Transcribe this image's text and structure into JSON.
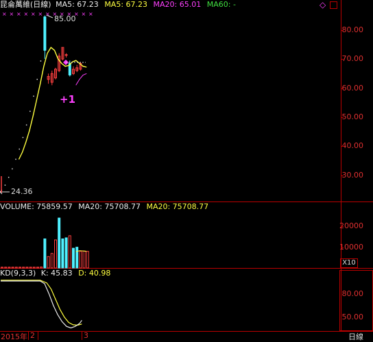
{
  "price_panel": {
    "name": "昆侖萬維(日線)",
    "ma_label_1": "MA5: 67.23",
    "ma_label_2": "MA5: 67.23",
    "ma_label_3": "MA20: 65.01",
    "ma_label_4": "MA60: -",
    "high_label": "85.00",
    "low_label": "24.36",
    "signal_label": "+1",
    "y_ticks": [
      "80.00",
      "70.00",
      "60.00",
      "50.00",
      "40.00",
      "30.00"
    ]
  },
  "volume_panel": {
    "label_1": "VOLUME: 75859.57",
    "label_2": "MA20: 75708.77",
    "label_3": "MA20: 75708.77",
    "y_ticks": [
      "20000",
      "10000"
    ],
    "unit": "X10"
  },
  "kd_panel": {
    "label_1": "KD(9,3,3)",
    "label_2": "K: 45.83",
    "label_3": "D: 40.98",
    "y_ticks": [
      "80.00",
      "50.00"
    ]
  },
  "footer": {
    "date_1": "2015年",
    "date_2": "2",
    "date_3": "3",
    "period": "日線"
  },
  "colors": {
    "up": "#ff4040",
    "down": "#4ff0ff",
    "ma_yellow": "#ffff40",
    "magenta": "#ff40ff",
    "green": "#40e040",
    "axis_red": "#b00000"
  },
  "chart_data": [
    {
      "type": "candlestick",
      "y_range": [
        21,
        87
      ],
      "x": [
        1,
        2,
        3,
        4,
        5,
        6,
        7,
        8,
        9,
        10,
        11,
        12,
        13,
        14,
        15,
        16,
        17,
        18,
        19,
        20,
        21,
        22,
        23,
        24,
        25,
        26,
        27,
        28,
        29,
        30,
        31,
        32,
        33,
        34,
        35,
        36,
        37,
        38,
        39,
        40,
        41,
        42,
        43,
        44,
        45,
        46,
        47,
        48,
        49,
        50,
        51,
        52,
        53,
        54,
        55,
        56,
        57,
        58,
        59,
        60,
        61,
        62,
        63
      ],
      "ohlc_note": "open/high/low/close per bar",
      "bars": [
        {
          "o": 24.36,
          "h": 24.36,
          "l": 24.36,
          "c": 24.36
        },
        {
          "o": 26.8,
          "h": 26.8,
          "l": 26.8,
          "c": 26.8
        },
        {
          "o": 29.5,
          "h": 29.5,
          "l": 29.5,
          "c": 29.5
        },
        {
          "o": 32.4,
          "h": 32.4,
          "l": 32.4,
          "c": 32.4
        },
        {
          "o": 35.7,
          "h": 35.7,
          "l": 35.7,
          "c": 35.7
        },
        {
          "o": 39.2,
          "h": 39.2,
          "l": 39.2,
          "c": 39.2
        },
        {
          "o": 43.2,
          "h": 43.2,
          "l": 43.2,
          "c": 43.2
        },
        {
          "o": 47.5,
          "h": 47.5,
          "l": 47.5,
          "c": 47.5
        },
        {
          "o": 52.2,
          "h": 52.2,
          "l": 52.2,
          "c": 52.2
        },
        {
          "o": 57.4,
          "h": 57.4,
          "l": 57.4,
          "c": 57.4
        },
        {
          "o": 63.2,
          "h": 63.2,
          "l": 63.2,
          "c": 63.2
        },
        {
          "o": 69.5,
          "h": 69.5,
          "l": 69.5,
          "c": 69.5
        },
        {
          "o": 84.5,
          "h": 85.0,
          "l": 70.0,
          "c": 73.0
        },
        {
          "o": 63.0,
          "h": 65.0,
          "l": 61.5,
          "c": 64.0
        },
        {
          "o": 62.0,
          "h": 66.0,
          "l": 61.0,
          "c": 65.0
        },
        {
          "o": 63.5,
          "h": 67.0,
          "l": 63.0,
          "c": 66.5
        },
        {
          "o": 66.0,
          "h": 72.0,
          "l": 65.5,
          "c": 71.0
        },
        {
          "o": 70.0,
          "h": 74.0,
          "l": 69.5,
          "c": 74.0
        },
        {
          "o": 71.5,
          "h": 72.0,
          "l": 70.5,
          "c": 71.5
        },
        {
          "o": 68.5,
          "h": 69.5,
          "l": 64.0,
          "c": 64.5
        },
        {
          "o": 65.0,
          "h": 67.5,
          "l": 64.5,
          "c": 66.5
        },
        {
          "o": 66.0,
          "h": 68.0,
          "l": 65.5,
          "c": 67.0
        },
        {
          "o": 66.5,
          "h": 69.0,
          "l": 66.0,
          "c": 68.5
        }
      ],
      "ma5": [
        [
          6,
          35.5
        ],
        [
          7,
          38
        ],
        [
          8,
          41.5
        ],
        [
          9,
          45.5
        ],
        [
          10,
          50.5
        ],
        [
          11,
          56
        ],
        [
          12,
          61.5
        ],
        [
          13,
          67.5
        ],
        [
          14,
          72
        ],
        [
          15,
          74
        ],
        [
          16,
          73
        ],
        [
          17,
          70
        ],
        [
          18,
          68.5
        ],
        [
          19,
          67.5
        ],
        [
          20,
          67.8
        ],
        [
          21,
          69
        ],
        [
          22,
          69.5
        ],
        [
          23,
          68.5
        ],
        [
          24,
          67.5
        ],
        [
          25,
          67.2
        ]
      ],
      "ma20": [
        [
          22,
          61
        ],
        [
          23,
          63
        ],
        [
          24,
          64.5
        ],
        [
          25,
          65.01
        ]
      ]
    },
    {
      "type": "bar",
      "title": "VOLUME",
      "y_range": [
        0,
        27000
      ],
      "values": [
        400,
        400,
        400,
        400,
        400,
        400,
        400,
        400,
        400,
        400,
        400,
        500,
        14000,
        5500,
        7000,
        13500,
        24000,
        14000,
        14500,
        15500,
        9500,
        10000,
        8000,
        8200,
        8000
      ],
      "colors_note": "index 12,16,17,18,20,21 cyan (down); rest red (up)"
    },
    {
      "type": "line",
      "title": "KD(9,3,3)",
      "y_range": [
        32,
        100
      ],
      "series": [
        {
          "name": "K",
          "values": [
            [
              1,
              96.5
            ],
            [
              19,
              96.5
            ],
            [
              21,
              93
            ],
            [
              23,
              80
            ],
            [
              25,
              65
            ],
            [
              27,
              53
            ],
            [
              29,
              44
            ],
            [
              31,
              38
            ],
            [
              33,
              36
            ],
            [
              35,
              38
            ],
            [
              37,
              42
            ],
            [
              38,
              45.83
            ]
          ]
        },
        {
          "name": "D",
          "values": [
            [
              1,
              97.5
            ],
            [
              19,
              97.5
            ],
            [
              22,
              94
            ],
            [
              24,
              86
            ],
            [
              26,
              73
            ],
            [
              28,
              60
            ],
            [
              30,
              50
            ],
            [
              32,
              43
            ],
            [
              34,
              40
            ],
            [
              36,
              39.5
            ],
            [
              38,
              40.98
            ]
          ]
        }
      ]
    }
  ]
}
